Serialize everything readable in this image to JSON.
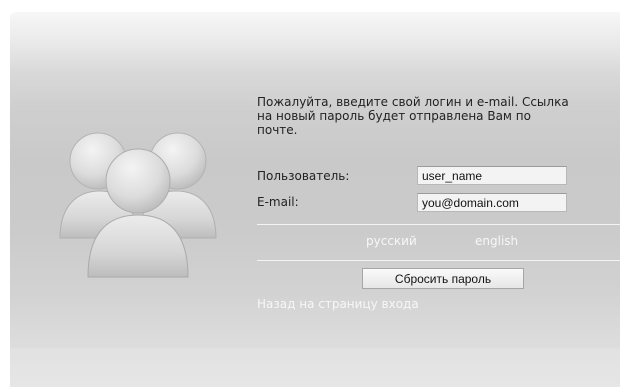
{
  "message": {
    "line1": "Пожалуйта, введите свой логин и e-mail. Ссылка",
    "line2": "на новый пароль будет отправлена Вам по",
    "line3": "почте."
  },
  "form": {
    "username_label": "Пользователь:",
    "username_value": "user_name",
    "email_label": "E-mail:",
    "email_value": "you@domain.com"
  },
  "languages": {
    "russian": "русский",
    "english": "english"
  },
  "reset_button_label": "Сбросить пароль",
  "back_link_label": "Назад на страницу входа",
  "icons": {
    "users_graphic": "users-group-icon"
  },
  "colors": {
    "link": "#f7f7f7",
    "text": "#222222"
  }
}
